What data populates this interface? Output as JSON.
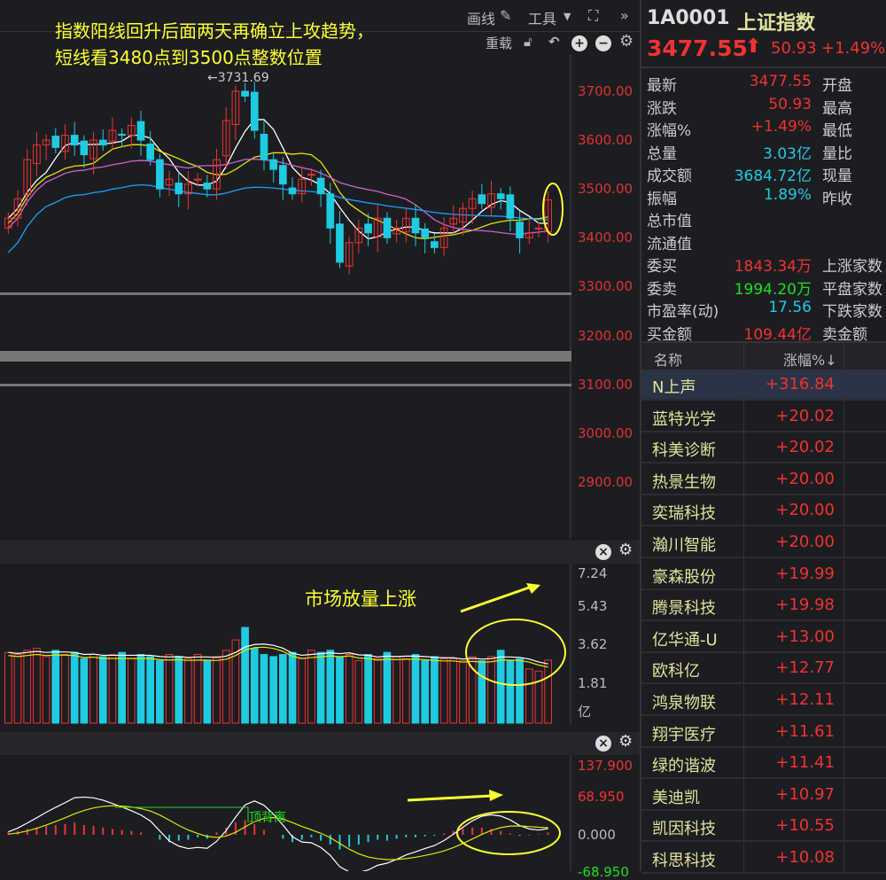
{
  "toolbar": {
    "draw": "画线",
    "tools": "工具",
    "reload": "重载"
  },
  "annotations": {
    "main_line1": "指数阳线回升后面两天再确立上攻趋势，",
    "main_line2": "短线看3480点到3500点整数位置",
    "peak_label": "←3731.69",
    "volume_note": "市场放量上涨",
    "macd_note": "顶背离"
  },
  "price_axis": [
    "3700.00",
    "3600.00",
    "3500.00",
    "3400.00",
    "3300.00",
    "3200.00",
    "3100.00",
    "3000.00",
    "2900.00"
  ],
  "volume_axis": [
    "7.24",
    "5.43",
    "3.62",
    "1.81",
    "亿"
  ],
  "macd_axis": [
    "137.900",
    "68.950",
    "0.000",
    "-68.950"
  ],
  "quote": {
    "code": "1A0001",
    "name": "上证指数",
    "price": "3477.55",
    "change": "50.93",
    "pct": "+1.49%",
    "rows": [
      {
        "label": "最新",
        "value": "3477.55",
        "color": "red",
        "right": "开盘"
      },
      {
        "label": "涨跌",
        "value": "50.93",
        "color": "red",
        "right": "最高"
      },
      {
        "label": "涨幅%",
        "value": "+1.49%",
        "color": "red",
        "right": "最低"
      },
      {
        "label": "总量",
        "value": "3.03亿",
        "color": "cyan",
        "right": "量比"
      },
      {
        "label": "成交额",
        "value": "3684.72亿",
        "color": "cyan",
        "right": "现量"
      },
      {
        "label": "振幅",
        "value": "1.89%",
        "color": "cyan",
        "right": "昨收"
      },
      {
        "label": "总市值",
        "value": "",
        "color": "cyan",
        "right": ""
      },
      {
        "label": "流通值",
        "value": "",
        "color": "cyan",
        "right": ""
      },
      {
        "label": "委买",
        "value": "1843.34万",
        "color": "red",
        "right": "上涨家数"
      },
      {
        "label": "委卖",
        "value": "1994.20万",
        "color": "green",
        "right": "平盘家数"
      },
      {
        "label": "市盈率(动)",
        "value": "17.56",
        "color": "cyan",
        "right": "下跌家数"
      },
      {
        "label": "买金额",
        "value": "109.44亿",
        "color": "red",
        "right": "卖金额"
      }
    ]
  },
  "list": {
    "headers": [
      "名称",
      "涨幅%↓"
    ],
    "rows": [
      {
        "name": "N上声",
        "pct": "+316.84"
      },
      {
        "name": "蓝特光学",
        "pct": "+20.02"
      },
      {
        "name": "科美诊断",
        "pct": "+20.02"
      },
      {
        "name": "热景生物",
        "pct": "+20.00"
      },
      {
        "name": "奕瑞科技",
        "pct": "+20.00"
      },
      {
        "name": "瀚川智能",
        "pct": "+20.00"
      },
      {
        "name": "豪森股份",
        "pct": "+19.99"
      },
      {
        "name": "腾景科技",
        "pct": "+19.98"
      },
      {
        "name": "亿华通-U",
        "pct": "+13.00"
      },
      {
        "name": "欧科亿",
        "pct": "+12.77"
      },
      {
        "name": "鸿泉物联",
        "pct": "+12.11"
      },
      {
        "name": "翔宇医疗",
        "pct": "+11.61"
      },
      {
        "name": "绿的谐波",
        "pct": "+11.41"
      },
      {
        "name": "美迪凯",
        "pct": "+10.97"
      },
      {
        "name": "凯因科技",
        "pct": "+10.55"
      },
      {
        "name": "科思科技",
        "pct": "+10.08"
      }
    ]
  },
  "colors": {
    "up": "#f03232",
    "down": "#1ecbe1",
    "bg": "#1c1d21",
    "annotation": "#ffff30"
  },
  "chart_data": {
    "type": "candlestick",
    "ylim": [
      2850,
      3760
    ],
    "closes": [
      3440,
      3480,
      3560,
      3590,
      3600,
      3585,
      3610,
      3590,
      3570,
      3600,
      3590,
      3620,
      3610,
      3630,
      3600,
      3560,
      3500,
      3520,
      3490,
      3510,
      3520,
      3500,
      3560,
      3640,
      3700,
      3690,
      3620,
      3560,
      3540,
      3510,
      3490,
      3520,
      3530,
      3490,
      3420,
      3350,
      3390,
      3420,
      3410,
      3440,
      3400,
      3420,
      3440,
      3410,
      3400,
      3380,
      3420,
      3440,
      3460,
      3480,
      3470,
      3490,
      3480,
      3440,
      3400,
      3410,
      3420,
      3477.55
    ],
    "volume": [
      3.4,
      3.3,
      3.5,
      3.6,
      3.2,
      3.5,
      3.3,
      3.4,
      3.1,
      3.3,
      3.2,
      3.3,
      3.4,
      3.1,
      3.3,
      3.2,
      3.0,
      3.3,
      3.2,
      3.1,
      3.3,
      3.0,
      3.2,
      3.5,
      4.0,
      4.6,
      3.6,
      3.3,
      3.2,
      3.3,
      3.4,
      3.1,
      3.5,
      3.4,
      3.5,
      3.2,
      3.3,
      3.0,
      3.3,
      3.1,
      3.4,
      3.2,
      3.1,
      3.3,
      3.0,
      3.2,
      3.1,
      3.1,
      3.0,
      3.2,
      3.0,
      3.2,
      3.5,
      3.0,
      3.1,
      2.6,
      2.5,
      3.03
    ],
    "volume_ylim": [
      0,
      7.24
    ],
    "macd": [
      5,
      8,
      12,
      15,
      18,
      20,
      22,
      25,
      20,
      18,
      15,
      12,
      10,
      8,
      5,
      0,
      -10,
      -15,
      -12,
      -10,
      -5,
      -8,
      5,
      15,
      25,
      30,
      22,
      10,
      0,
      -8,
      -15,
      -10,
      -5,
      -12,
      -20,
      -30,
      -25,
      -20,
      -15,
      -10,
      -12,
      -8,
      -5,
      -5,
      -3,
      -2,
      3,
      8,
      12,
      15,
      15,
      12,
      8,
      3,
      -2,
      -1,
      1,
      5
    ],
    "macd_ylim": [
      -80,
      137.9
    ]
  }
}
